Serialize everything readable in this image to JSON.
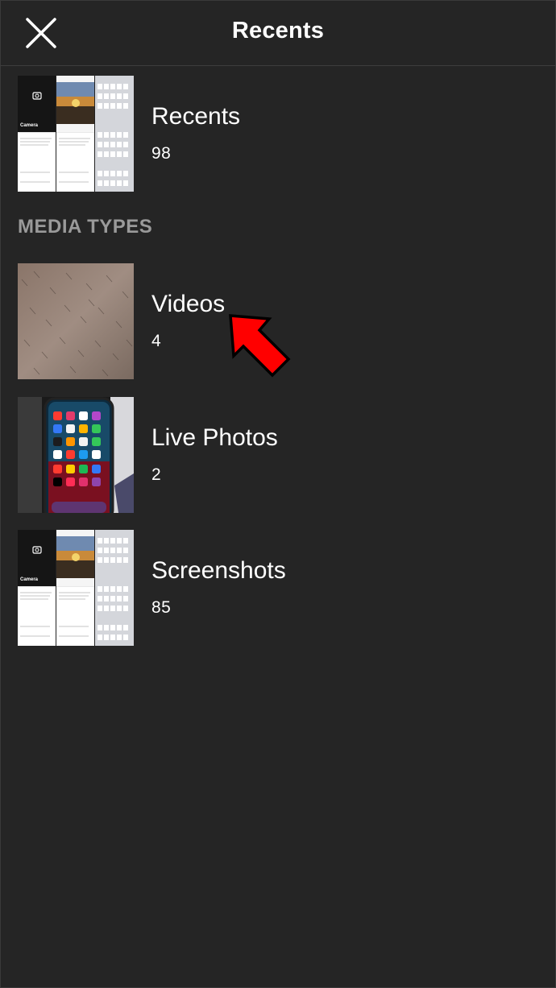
{
  "header": {
    "title": "Recents",
    "close_icon": "close-icon"
  },
  "albums": [
    {
      "title": "Recents",
      "count": "98",
      "thumb_label": "Camera"
    }
  ],
  "media_types": {
    "section_title": "MEDIA TYPES",
    "items": [
      {
        "title": "Videos",
        "count": "4"
      },
      {
        "title": "Live Photos",
        "count": "2"
      },
      {
        "title": "Screenshots",
        "count": "85",
        "thumb_label": "Camera"
      }
    ]
  },
  "annotation": {
    "arrow_color": "#ff0000",
    "arrow_icon": "pointer-arrow"
  },
  "colors": {
    "background": "#252525",
    "section_header": "#9a9a9a"
  }
}
